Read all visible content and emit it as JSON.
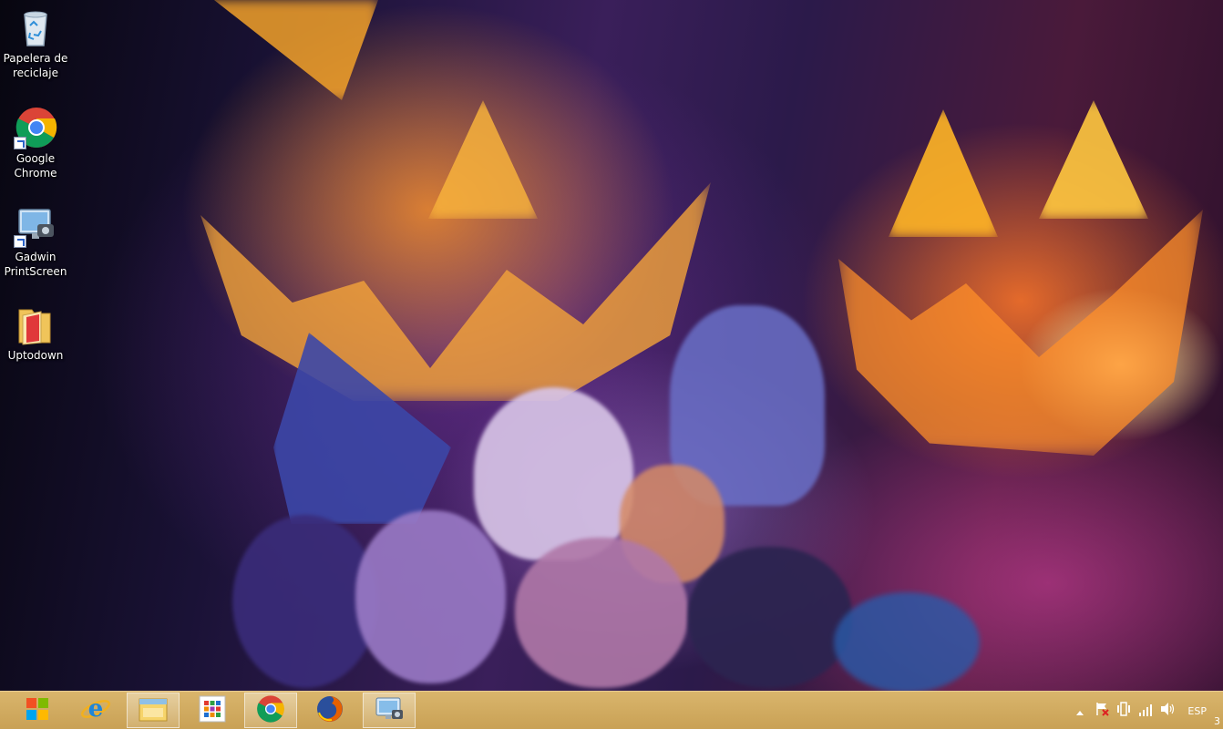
{
  "desktop": {
    "wallpaper": "halloween-pumpkins-candy",
    "icons": [
      {
        "label": "Papelera de\nreciclaje",
        "icon": "recycle-bin-icon"
      },
      {
        "label": "Google\nChrome",
        "icon": "chrome-icon"
      },
      {
        "label": "Gadwin\nPrintScreen",
        "icon": "gadwin-printscreen-icon"
      },
      {
        "label": "Uptodown",
        "icon": "uptodown-folder-icon"
      }
    ]
  },
  "taskbar": {
    "color": "#d4ad63",
    "buttons": [
      {
        "name": "start",
        "icon": "windows-logo-icon"
      },
      {
        "name": "internet-explorer",
        "icon": "internet-explorer-icon"
      },
      {
        "name": "file-explorer",
        "icon": "file-explorer-icon",
        "active": true
      },
      {
        "name": "apps",
        "icon": "apps-grid-icon"
      },
      {
        "name": "chrome",
        "icon": "chrome-icon",
        "active": true
      },
      {
        "name": "firefox",
        "icon": "firefox-icon"
      },
      {
        "name": "gadwin-printscreen",
        "icon": "printscreen-icon",
        "active": true
      }
    ],
    "tray": {
      "language": "ESP",
      "clock_fragment": "3",
      "icons": [
        "show-hidden-icons-chevron",
        "action-center-flag-icon",
        "power-icon",
        "network-signal-icon",
        "volume-icon"
      ]
    }
  }
}
